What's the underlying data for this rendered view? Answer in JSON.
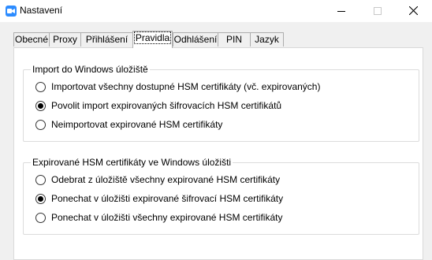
{
  "window": {
    "title": "Nastavení"
  },
  "tabs": [
    {
      "label": "Obecné"
    },
    {
      "label": "Proxy"
    },
    {
      "label": "Přihlášení"
    },
    {
      "label": "Pravidla",
      "active": true
    },
    {
      "label": "Odhlášení"
    },
    {
      "label": "PIN"
    },
    {
      "label": "Jazyk"
    }
  ],
  "import_group": {
    "legend": "Import do Windows úložiště",
    "options": [
      {
        "label": "Importovat všechny dostupné HSM certifikáty (vč. expirovaných)",
        "checked": false
      },
      {
        "label": "Povolit import expirovaných šifrovacích HSM certifikátů",
        "checked": true
      },
      {
        "label": "Neimportovat expirované HSM certifikáty",
        "checked": false
      }
    ]
  },
  "expired_group": {
    "legend": "Expirované HSM certifikáty ve Windows úložišti",
    "options": [
      {
        "label": "Odebrat z úložiště všechny expirované HSM certifikáty",
        "checked": false
      },
      {
        "label": "Ponechat v úložišti expirované šifrovací HSM certifikáty",
        "checked": true
      },
      {
        "label": "Ponechat v úložišti všechny expirované HSM certifikáty",
        "checked": false
      }
    ]
  }
}
